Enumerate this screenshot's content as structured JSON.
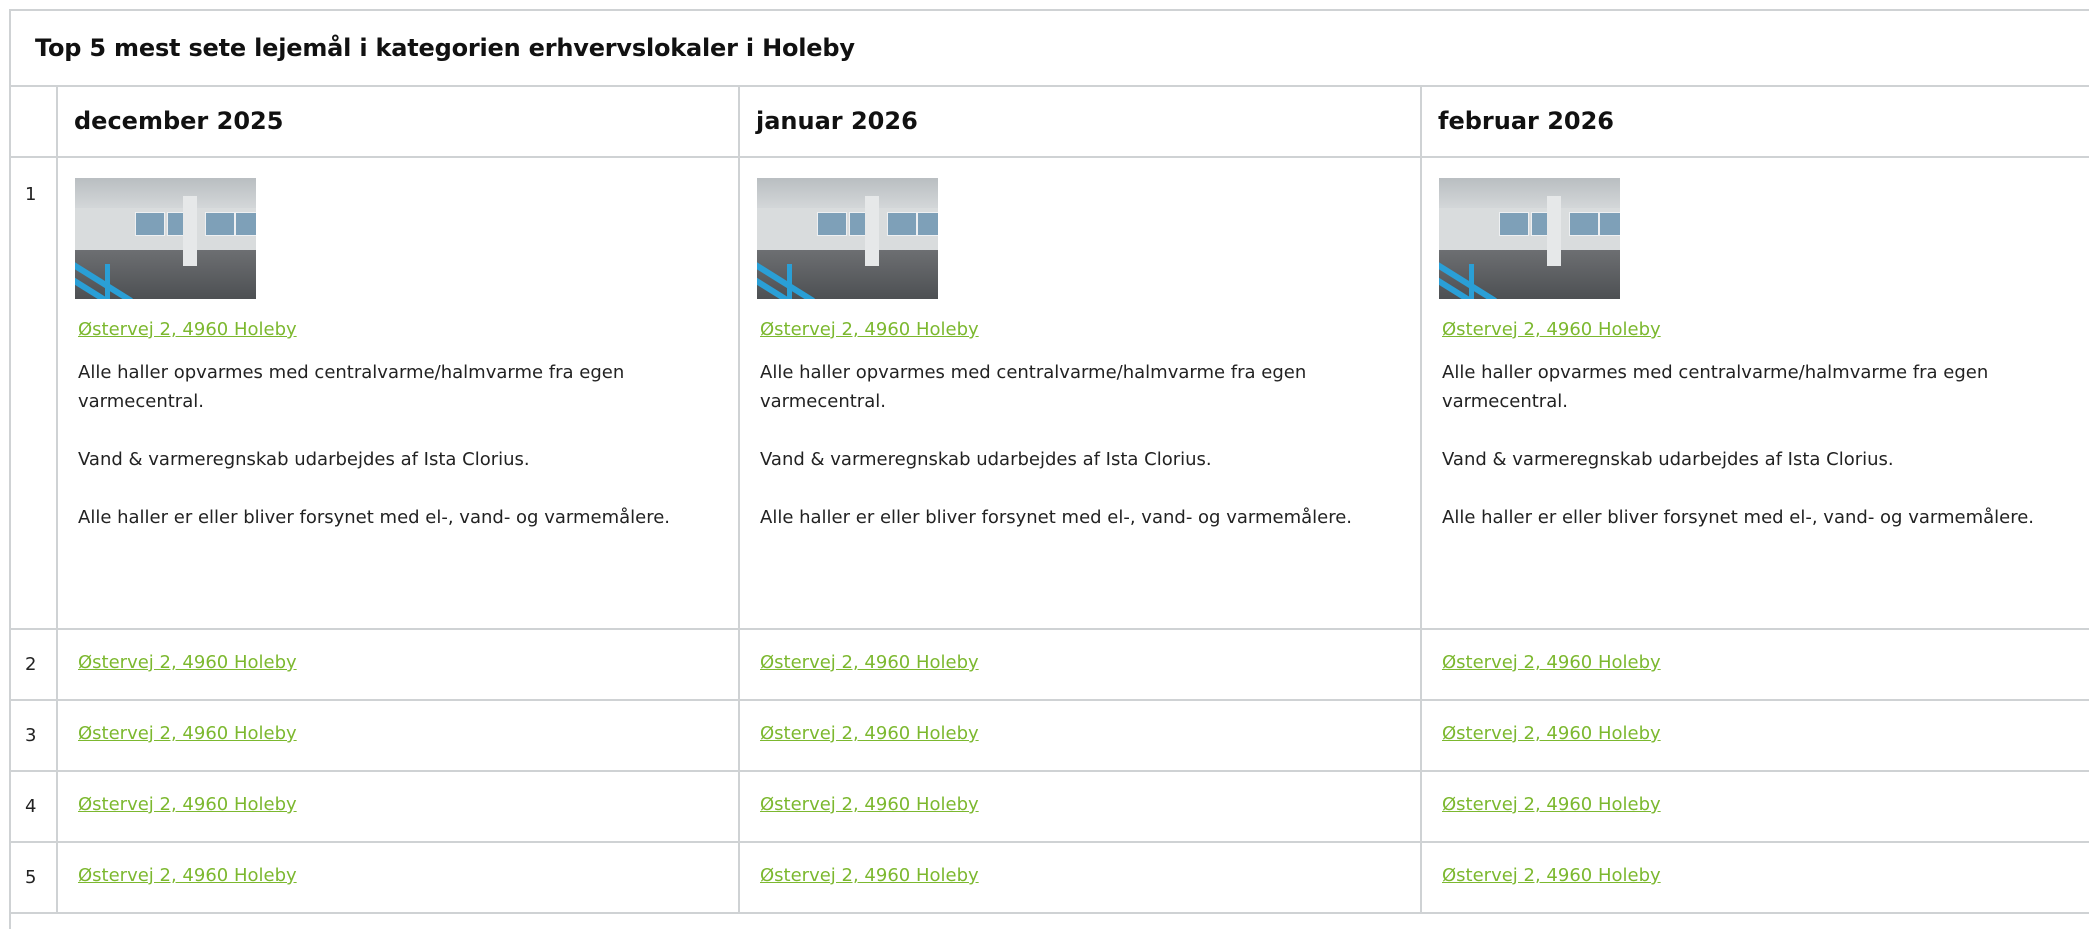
{
  "title": "Top 5 mest sete lejemål i kategorien erhvervslokaler i Holeby",
  "columns": [
    {
      "label": "december 2025"
    },
    {
      "label": "januar 2026"
    },
    {
      "label": "februar 2026"
    }
  ],
  "rank_labels": [
    "1",
    "2",
    "3",
    "4",
    "5"
  ],
  "listing_link": "Østervej 2, 4960 Holeby",
  "description": [
    "Alle haller opvarmes med centralvarme/halmvarme fra egen varmecentral.",
    "Vand & varmeregnskab udarbejdes af Ista Clorius.",
    "Alle haller er eller bliver forsynet med el-, vand- og varmemålere."
  ],
  "colors": {
    "link": "#7cb82f",
    "border": "#cfd2d4",
    "text": "#222222"
  }
}
